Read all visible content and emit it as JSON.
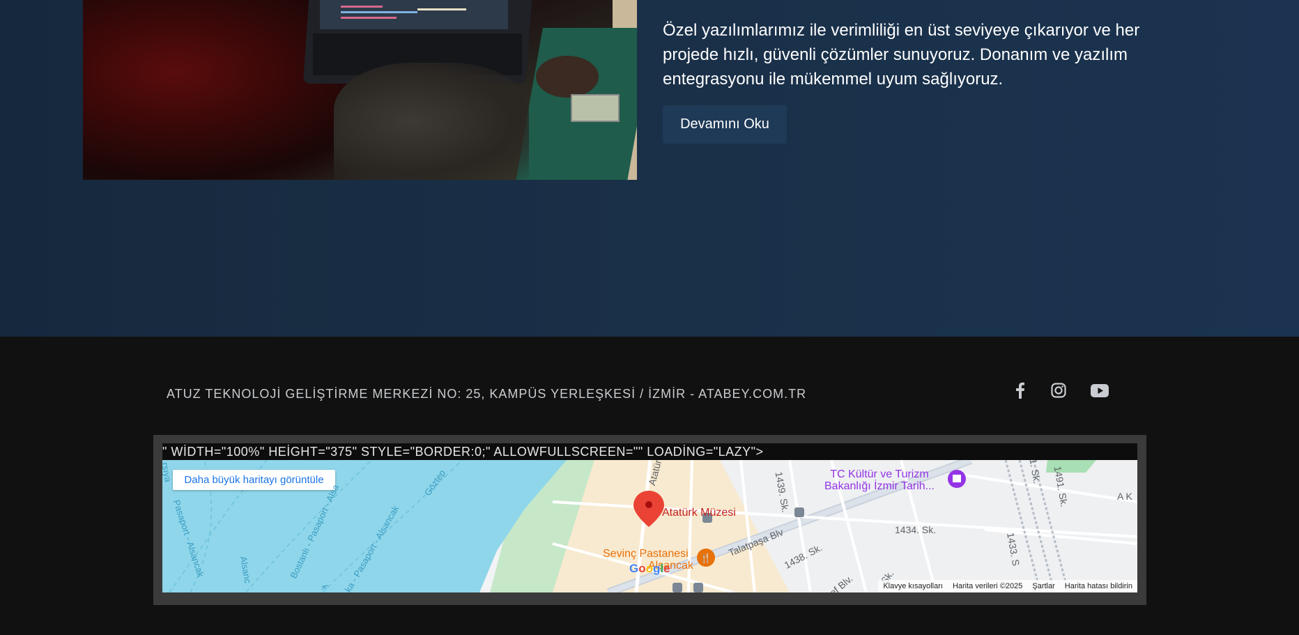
{
  "intro": {
    "text": "Özel yazılımlarımız ile verimliliği en üst seviyeye çıkarıyor ve her projede hızlı, güvenli çözümler sunuyoruz. Donanım ve yazılım entegrasyonu ile mükemmel uyum sağlıyoruz.",
    "button_label": "Devamını Oku"
  },
  "footer": {
    "address": "ATUZ TEKNOLOJİ GELİŞTİRME MERKEZİ NO: 25, KAMPÜS YERLEŞKESİ / İZMİR - ATABEY.COM.TR",
    "social": [
      {
        "icon": "facebook-icon"
      },
      {
        "icon": "instagram-icon"
      },
      {
        "icon": "youtube-icon"
      }
    ]
  },
  "map": {
    "code_text": "\" WİDTH=\"100%\" HEİGHT=\"375\" STYLE=\"BORDER:0;\" ALLOWFULLSCREEN=\"\" LOADİNG=\"LAZY\">",
    "bigger_map_label": "Daha büyük haritayı görüntüle",
    "poi_ataturk": "Atatürk Müzesi",
    "poi_sevinc_line1": "Sevinç Pastanesi",
    "poi_sevinc_line2": "Alsancak",
    "poi_kultur_line1": "TC Kültür ve Turizm",
    "poi_kultur_line2": "Bakanlığı İzmir Tarih...",
    "roads": {
      "talatpasa": "Talatpaşa Blv",
      "sk1439": "1439. Sk.",
      "sk1434": "1434. Sk.",
      "sk1438": "1438. Sk.",
      "sk1433": "1433. S",
      "sk1491": "1491. Sk.",
      "sk91": "91. Sk.",
      "ataturk": "Atatür",
      "ak": "A K",
      "blv": "ef Blv.",
      "sk": "Sk."
    },
    "water_labels": {
      "w1": "Bostanlı - Pasaport - Alsa",
      "w2": "Göztep",
      "w3": "ka - Pasaport - Alsancak",
      "w4": "Pasaport - Alsancak",
      "w5": "Alsanc",
      "w6": "k",
      "w7": "rşıya"
    },
    "google_logo_letters": [
      "G",
      "o",
      "o",
      "g",
      "l",
      "e"
    ],
    "attribution": {
      "shortcuts": "Klavye kısayolları",
      "data": "Harita verileri ©2025",
      "terms": "Şartlar",
      "report": "Harita hatası bildirin"
    },
    "colors": {
      "water": "#8fd6ea",
      "land": "#f8ead0",
      "park": "#c6e8c9",
      "accent": "#1a73e8"
    }
  }
}
